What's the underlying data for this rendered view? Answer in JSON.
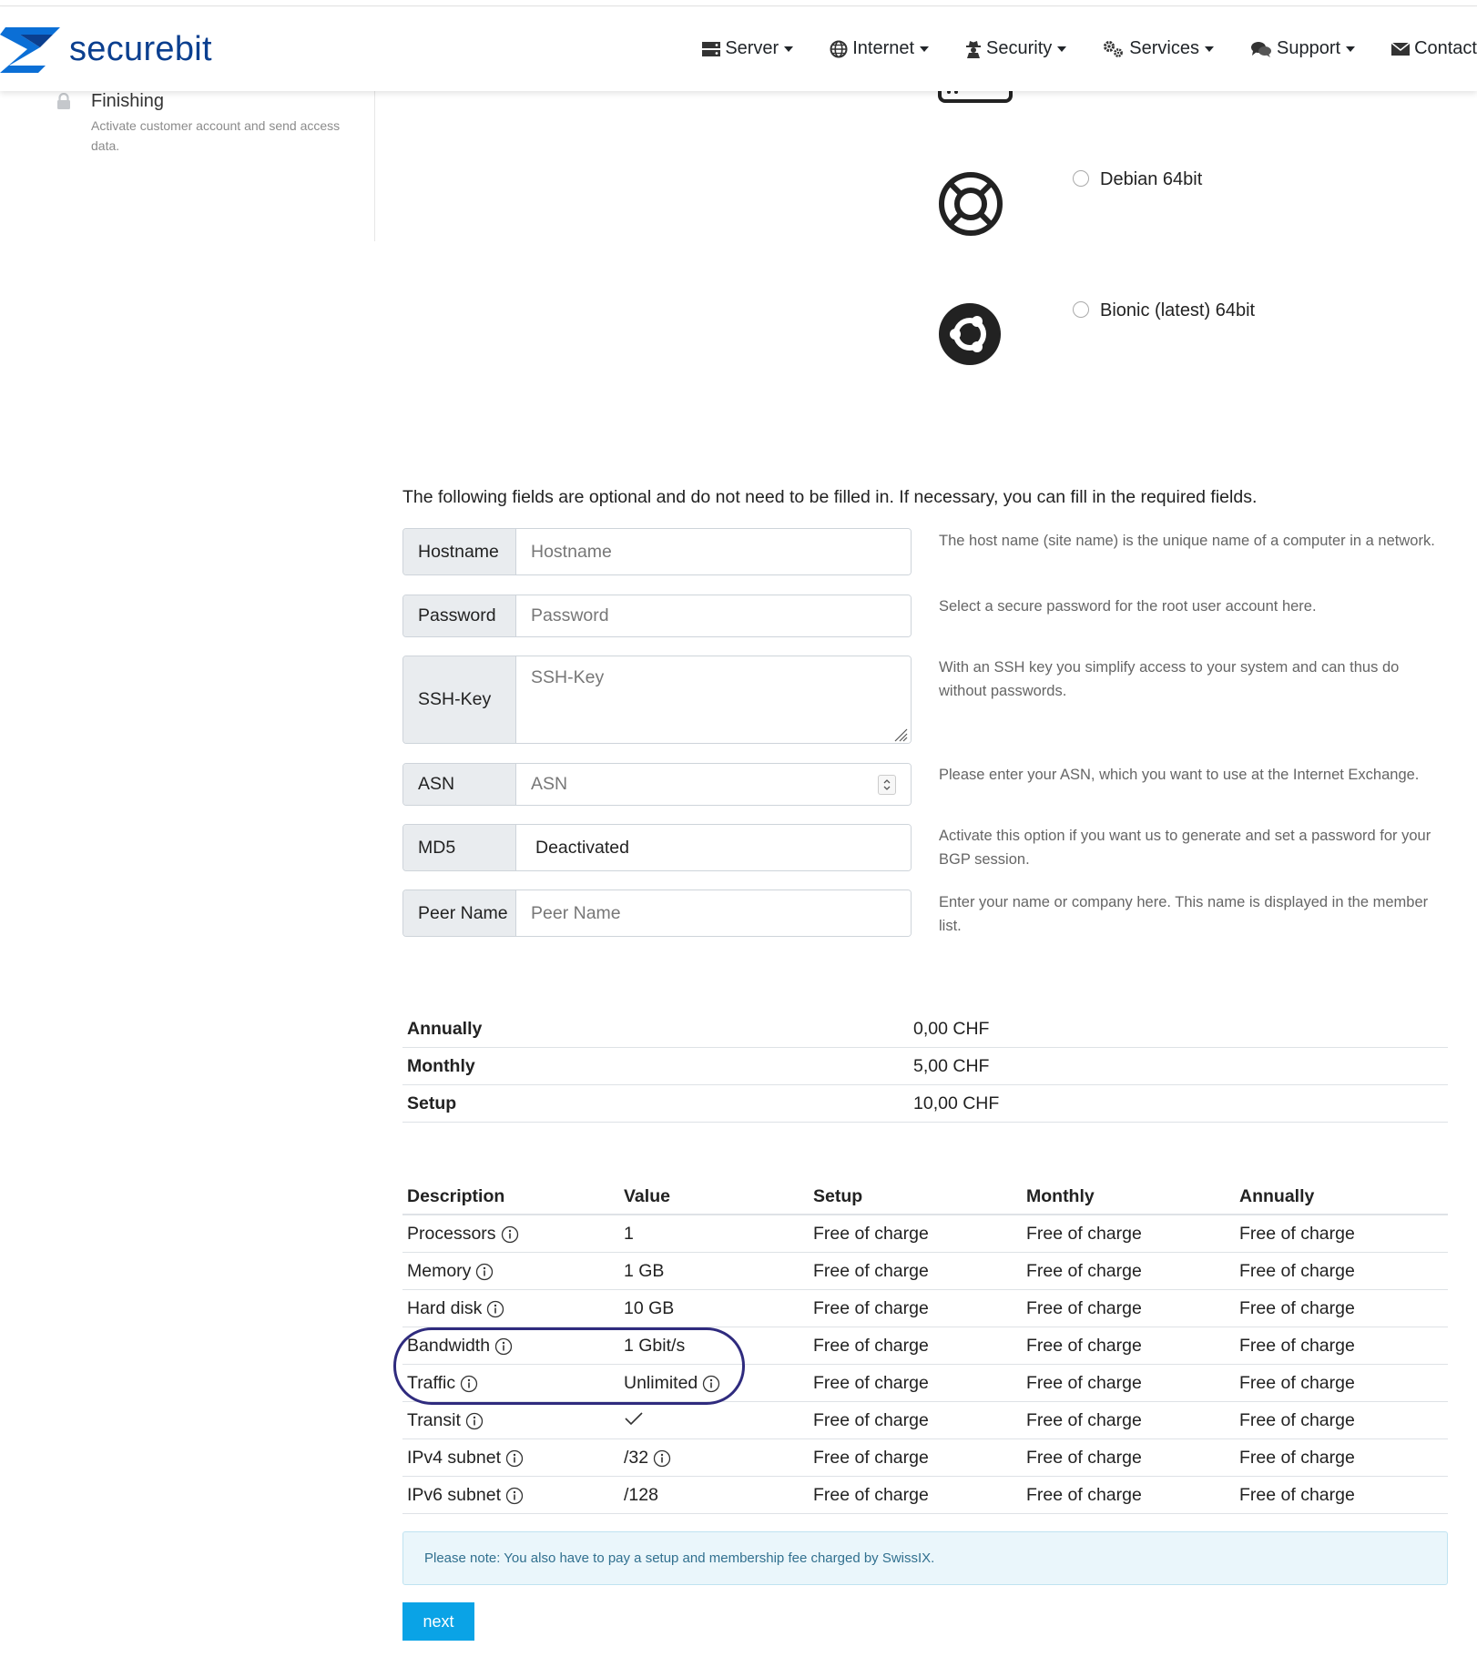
{
  "brand": {
    "name": "securebit",
    "primary": "#0b3f8f"
  },
  "nav": {
    "items": [
      {
        "label": "Server",
        "icon": "server-icon"
      },
      {
        "label": "Internet",
        "icon": "globe-icon"
      },
      {
        "label": "Security",
        "icon": "spy-icon"
      },
      {
        "label": "Services",
        "icon": "cogs-icon"
      },
      {
        "label": "Support",
        "icon": "chat-icon"
      },
      {
        "label": "Contact",
        "icon": "envelope-icon"
      }
    ]
  },
  "sidebar": {
    "step": {
      "title": "Finishing",
      "description": "Activate customer account and send access data.",
      "icon": "lock-icon"
    }
  },
  "os": {
    "options": [
      {
        "label": "Debian 64bit",
        "icon": "debian-icon",
        "selected": false
      },
      {
        "label": "Bionic (latest) 64bit",
        "icon": "ubuntu-icon",
        "selected": false
      }
    ]
  },
  "form": {
    "intro": "The following fields are optional and do not need to be filled in. If necessary, you can fill in the required fields.",
    "hostname": {
      "label": "Hostname",
      "placeholder": "Hostname",
      "help": "The host name (site name) is the unique name of a computer in a network."
    },
    "password": {
      "label": "Password",
      "placeholder": "Password",
      "help": "Select a secure password for the root user account here."
    },
    "sshkey": {
      "label": "SSH-Key",
      "placeholder": "SSH-Key",
      "help": "With an SSH key you simplify access to your system and can thus do without passwords."
    },
    "asn": {
      "label": "ASN",
      "placeholder": "ASN",
      "help": "Please enter your ASN, which you want to use at the Internet Exchange."
    },
    "md5": {
      "label": "MD5",
      "value": "Deactivated",
      "help": "Activate this option if you want us to generate and set a password for your BGP session."
    },
    "peername": {
      "label": "Peer Name",
      "placeholder": "Peer Name",
      "help": "Enter your name or company here. This name is displayed in the member list."
    }
  },
  "summary": {
    "rows": [
      {
        "key": "Annually",
        "value": "0,00 CHF"
      },
      {
        "key": "Monthly",
        "value": "5,00 CHF"
      },
      {
        "key": "Setup",
        "value": "10,00 CHF"
      }
    ]
  },
  "table": {
    "headers": [
      "Description",
      "Value",
      "Setup",
      "Monthly",
      "Annually"
    ],
    "rows": [
      {
        "description": "Processors",
        "value": "1",
        "setup": "Free of charge",
        "monthly": "Free of charge",
        "annually": "Free of charge"
      },
      {
        "description": "Memory",
        "value": "1 GB",
        "setup": "Free of charge",
        "monthly": "Free of charge",
        "annually": "Free of charge"
      },
      {
        "description": "Hard disk",
        "value": "10 GB",
        "setup": "Free of charge",
        "monthly": "Free of charge",
        "annually": "Free of charge"
      },
      {
        "description": "Bandwidth",
        "value": "1 Gbit/s",
        "setup": "Free of charge",
        "monthly": "Free of charge",
        "annually": "Free of charge"
      },
      {
        "description": "Traffic",
        "value": "Unlimited",
        "setup": "Free of charge",
        "monthly": "Free of charge",
        "annually": "Free of charge"
      },
      {
        "description": "Transit",
        "value": "",
        "setup": "Free of charge",
        "monthly": "Free of charge",
        "annually": "Free of charge"
      },
      {
        "description": "IPv4 subnet",
        "value": "/32",
        "setup": "Free of charge",
        "monthly": "Free of charge",
        "annually": "Free of charge"
      },
      {
        "description": "IPv6 subnet",
        "value": "/128",
        "setup": "Free of charge",
        "monthly": "Free of charge",
        "annually": "Free of charge"
      }
    ]
  },
  "note": "Please note: You also have to pay a setup and membership fee charged by SwissIX.",
  "next_label": "next",
  "accent_color": "#0aa3e6"
}
